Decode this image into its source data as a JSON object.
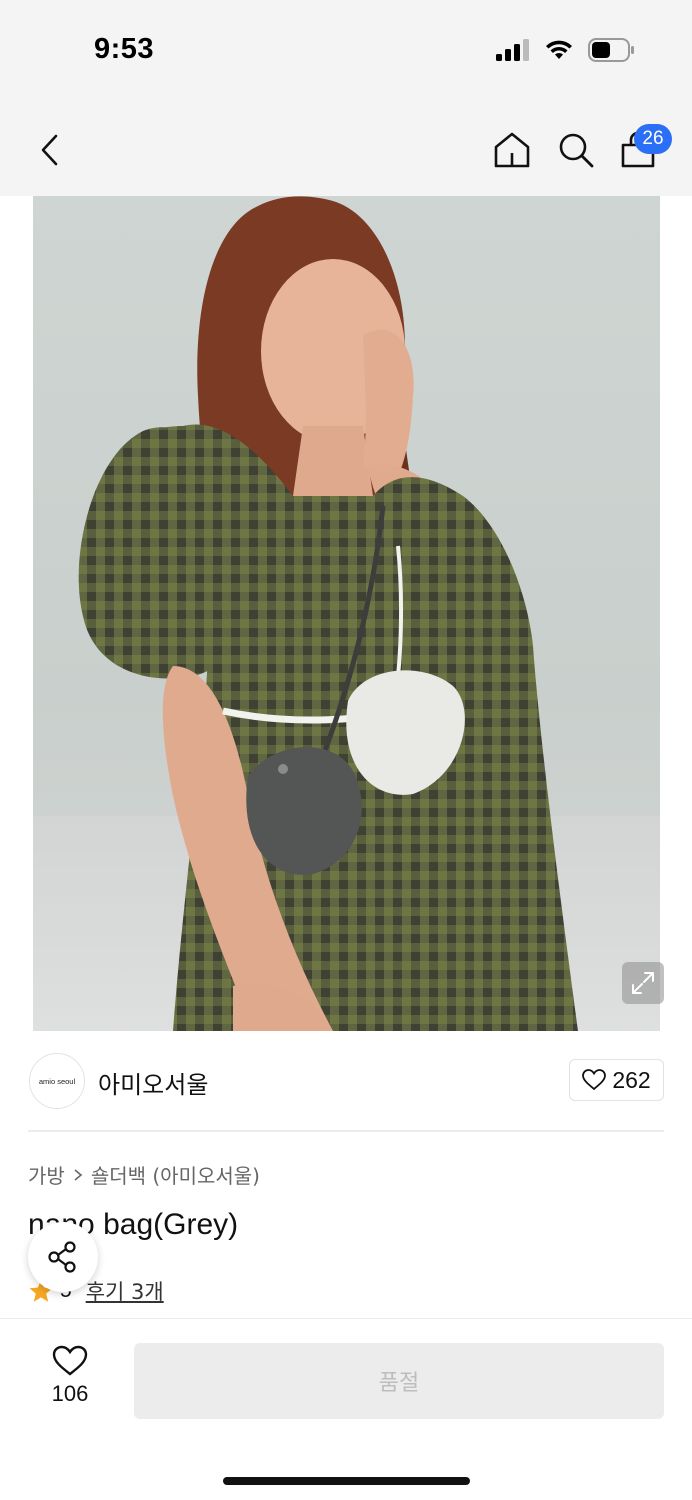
{
  "status_bar": {
    "time": "9:53",
    "icons": [
      "signal-icon",
      "wifi-icon",
      "battery-icon"
    ]
  },
  "nav": {
    "icons": [
      "back-icon",
      "home-icon",
      "search-icon",
      "cart-icon"
    ],
    "cart_badge": "26"
  },
  "hero": {
    "icon": "expand-icon"
  },
  "brand": {
    "logo_text": "amio seoul",
    "name": "아미오서울",
    "like_count": "262"
  },
  "product": {
    "breadcrumb": [
      "가방",
      "숄더백 (아미오서울)"
    ],
    "title": "nano bag(Grey)",
    "rating": "5",
    "reviews_label": "후기 3개"
  },
  "bottom": {
    "wish_count": "106",
    "soldout_label": "품절"
  },
  "colors": {
    "badge": "#2a6ff5",
    "star": "#f5a623",
    "soldout_bg": "#ececec",
    "soldout_text": "#bdbdbd"
  }
}
